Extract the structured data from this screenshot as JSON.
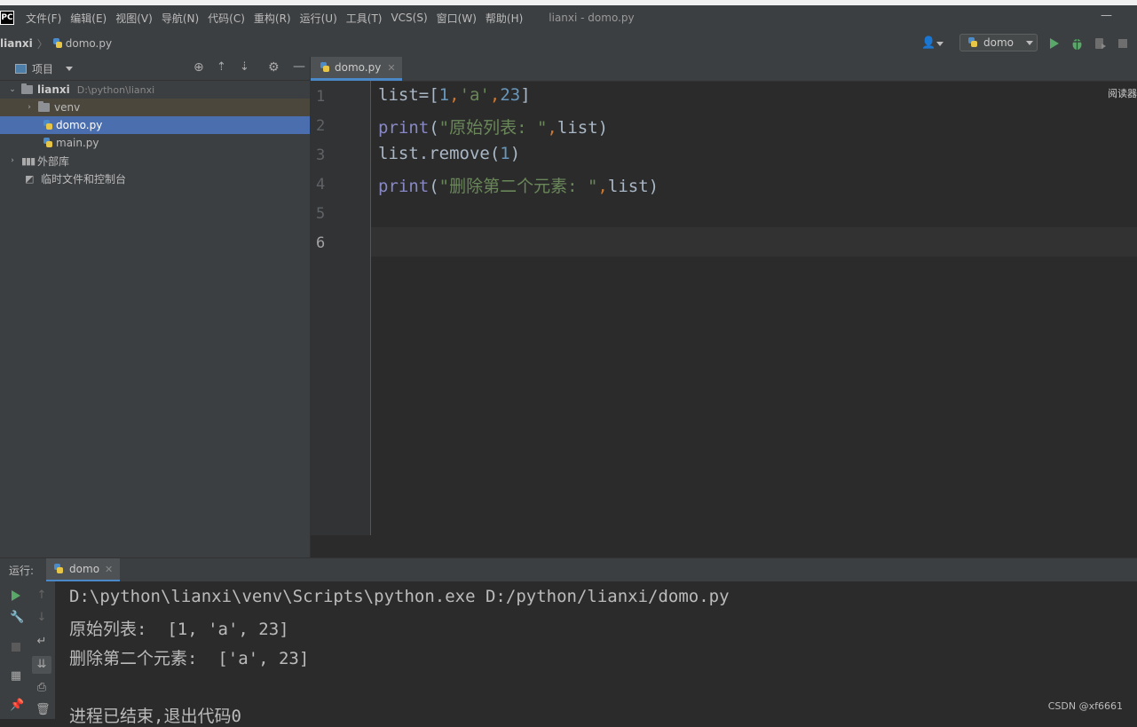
{
  "window": {
    "title": "lianxi - domo.py"
  },
  "menu": [
    "文件(F)",
    "编辑(E)",
    "视图(V)",
    "导航(N)",
    "代码(C)",
    "重构(R)",
    "运行(U)",
    "工具(T)",
    "VCS(S)",
    "窗口(W)",
    "帮助(H)"
  ],
  "breadcrumb": {
    "project": "lianxi",
    "file": "domo.py"
  },
  "run_config": {
    "label": "domo"
  },
  "project_panel": {
    "title": "项目",
    "tree": [
      {
        "label": "lianxi",
        "path": "D:\\python\\lianxi"
      },
      {
        "label": "venv"
      },
      {
        "label": "domo.py",
        "selected": true
      },
      {
        "label": "main.py"
      },
      {
        "label": "外部库"
      },
      {
        "label": "临时文件和控制台"
      }
    ]
  },
  "editor": {
    "tab": "domo.py",
    "reader_mode": "阅读器",
    "code": [
      {
        "n": "1",
        "text": "list=[1,'a',23]"
      },
      {
        "n": "2",
        "text": "print(\"原始列表: \",list)"
      },
      {
        "n": "3",
        "text": "list.remove(1)"
      },
      {
        "n": "4",
        "text": "print(\"删除第二个元素: \",list)"
      },
      {
        "n": "5",
        "text": ""
      },
      {
        "n": "6",
        "text": ""
      }
    ],
    "code_tokens": {
      "l1_list": "list",
      "l1_eq": "=",
      "l1_lb": "[",
      "l1_1": "1",
      "l1_c1": ",",
      "l1_a": "'a'",
      "l1_c2": ",",
      "l1_23": "23",
      "l1_rb": "]",
      "l2_print": "print",
      "l2_lp": "(",
      "l2_str": "\"原始列表: \"",
      "l2_c": ",",
      "l2_list": "list",
      "l2_rp": ")",
      "l3_a": "list.remove(",
      "l3_1": "1",
      "l3_rp": ")",
      "l4_print": "print",
      "l4_lp": "(",
      "l4_str": "\"删除第二个元素: \"",
      "l4_c": ",",
      "l4_list": "list",
      "l4_rp": ")"
    }
  },
  "run_panel": {
    "label": "运行:",
    "tab": "domo",
    "output": [
      "D:\\python\\lianxi\\venv\\Scripts\\python.exe D:/python/lianxi/domo.py",
      "原始列表:  [1, 'a', 23]",
      "删除第二个元素:  ['a', 23]",
      "",
      "进程已结束,退出代码0"
    ]
  },
  "watermark": "CSDN @xf6661"
}
